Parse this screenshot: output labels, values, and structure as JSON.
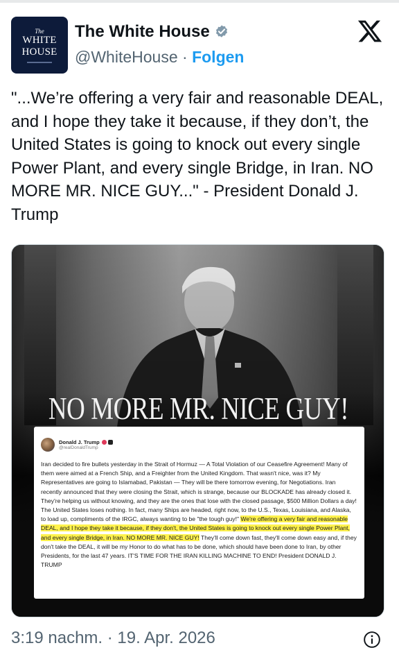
{
  "account": {
    "avatar_lines": [
      "The",
      "WHITE",
      "HOUSE"
    ],
    "name": "The White House",
    "handle": "@WhiteHouse",
    "separator": " · ",
    "follow_label": "Folgen"
  },
  "icons": {
    "verified": "verified-badge-icon",
    "platform": "x-logo-icon",
    "info": "info-icon"
  },
  "colors": {
    "accent": "#1d9bf0",
    "verified": "#829aab",
    "highlight": "#fff24d"
  },
  "tweet": {
    "text": "\"...We’re offering a very fair and reasonable DEAL, and I hope they take it because, if they don’t, the United States is going to knock out every single Power Plant, and every single Bridge, in Iran. NO MORE MR. NICE GUY...\" - President Donald J. Trump",
    "timestamp": "3:19 nachm. · 19. Apr. 2026"
  },
  "image": {
    "headline": "NO MORE MR. NICE GUY!",
    "post": {
      "author": "Donald J. Trump",
      "handle": "@realDonaldTrump",
      "body_before": "Iran decided to fire bullets yesterday in the Strait of Hormuz — A Total Violation of our Ceasefire Agreement! Many of them were aimed at a French Ship, and a Freighter from the United Kingdom. That wasn't nice, was it? My Representatives are going to Islamabad, Pakistan — They will be there tomorrow evening, for Negotiations. Iran recently announced that they were closing the Strait, which is strange, because our BLOCKADE has already closed it. They're helping us without knowing, and they are the ones that lose with the closed passage, $500 Million Dollars a day! The United States loses nothing. In fact, many Ships are headed, right now, to the U.S., Texas, Louisiana, and Alaska, to load up, compliments of the IRGC, always wanting to be \"the tough guy!\" ",
      "body_highlight": "We're offering a very fair and reasonable DEAL, and I hope they take it because, if they don't, the United States is going to knock out every single Power Plant, and every single Bridge, in Iran. NO MORE MR. NICE GUY!",
      "body_after": " They'll come down fast, they'll come down easy and, if they don't take the DEAL, it will be my Honor to do what has to be done, which should have been done to Iran, by other Presidents, for the last 47 years. IT'S TIME FOR THE IRAN KILLING MACHINE TO END! President DONALD J. TRUMP"
    }
  }
}
